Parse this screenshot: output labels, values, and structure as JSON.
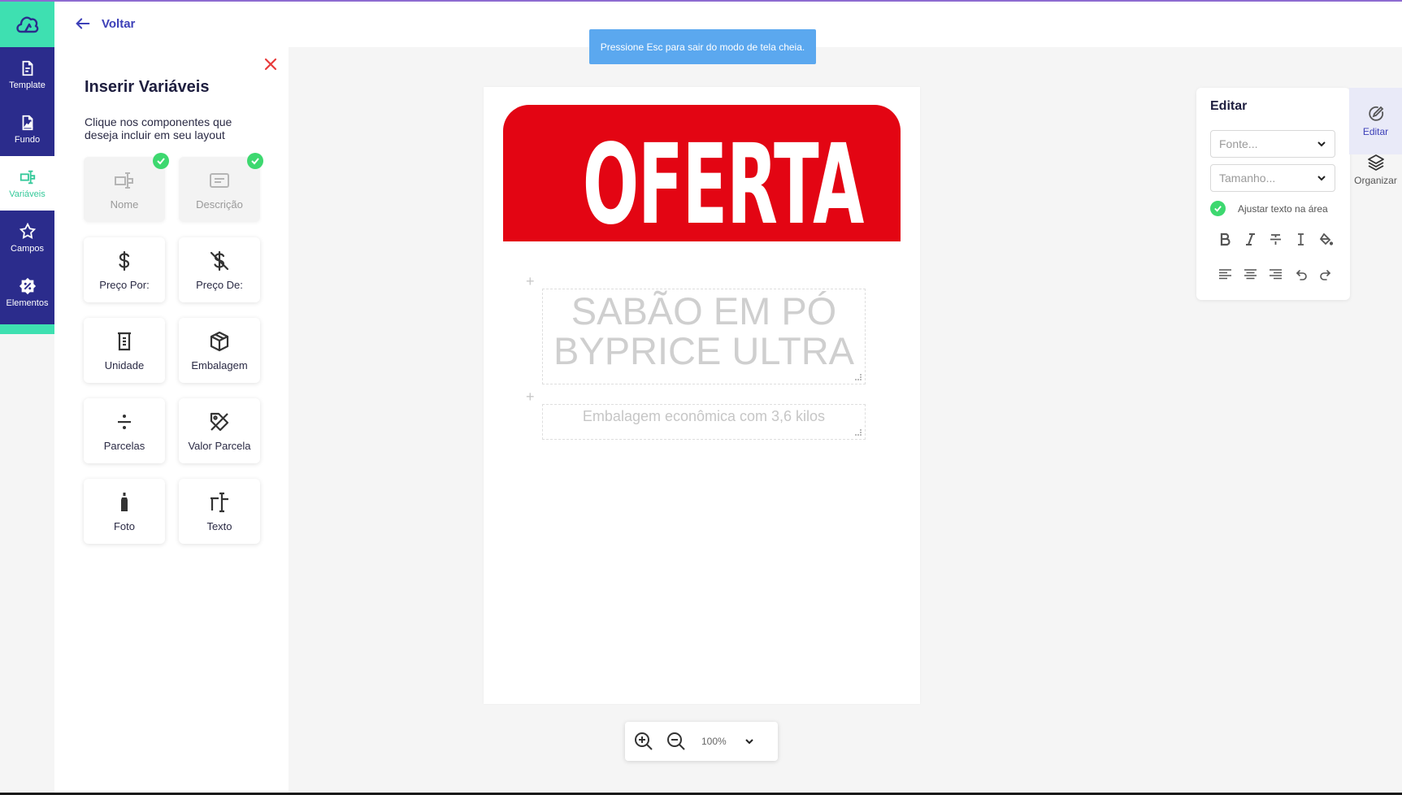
{
  "nav": {
    "items": [
      {
        "label": "Template",
        "icon": "template-icon"
      },
      {
        "label": "Fundo",
        "icon": "image-icon"
      },
      {
        "label": "Variáveis",
        "icon": "variables-icon"
      },
      {
        "label": "Campos",
        "icon": "star-icon"
      },
      {
        "label": "Elementos",
        "icon": "elements-icon"
      }
    ],
    "active": "Variáveis"
  },
  "topbar": {
    "back_label": "Voltar",
    "toast": "Pressione Esc para sair do modo de tela cheia."
  },
  "variables_panel": {
    "title": "Inserir Variáveis",
    "description": "Clique nos componentes que deseja incluir em seu layout",
    "cards": [
      {
        "label": "Nome",
        "icon": "name-field-icon",
        "selected": true
      },
      {
        "label": "Descrição",
        "icon": "description-icon",
        "selected": true
      },
      {
        "label": "Preço Por:",
        "icon": "dollar-icon",
        "selected": false
      },
      {
        "label": "Preço De:",
        "icon": "dollar-off-icon",
        "selected": false
      },
      {
        "label": "Unidade",
        "icon": "beaker-icon",
        "selected": false
      },
      {
        "label": "Embalagem",
        "icon": "box-icon",
        "selected": false
      },
      {
        "label": "Parcelas",
        "icon": "divide-icon",
        "selected": false
      },
      {
        "label": "Valor Parcela",
        "icon": "tag-off-icon",
        "selected": false
      },
      {
        "label": "Foto",
        "icon": "bottle-icon",
        "selected": false
      },
      {
        "label": "Texto",
        "icon": "text-icon",
        "selected": false
      }
    ]
  },
  "canvas": {
    "banner_text": "OFERTA",
    "banner_color": "#e30513",
    "product_name": "SABÃO EM PÓ BYPRICE ULTRA",
    "product_description": "Embalagem econômica com 3,6 kilos"
  },
  "zoom": {
    "value": "100%"
  },
  "edit_panel": {
    "title": "Editar",
    "font_placeholder": "Fonte...",
    "size_placeholder": "Tamanho...",
    "fit_label": "Ajustar texto na área",
    "fit_checked": true
  },
  "right_tabs": [
    {
      "label": "Editar",
      "icon": "edit-circle-icon",
      "active": true
    },
    {
      "label": "Organizar",
      "icon": "layers-icon",
      "active": false
    }
  ],
  "colors": {
    "accent_green": "#3ee0b1",
    "nav_blue": "#2b2c8c",
    "toast_blue": "#5ba8ef",
    "check_green": "#3dd86f"
  }
}
